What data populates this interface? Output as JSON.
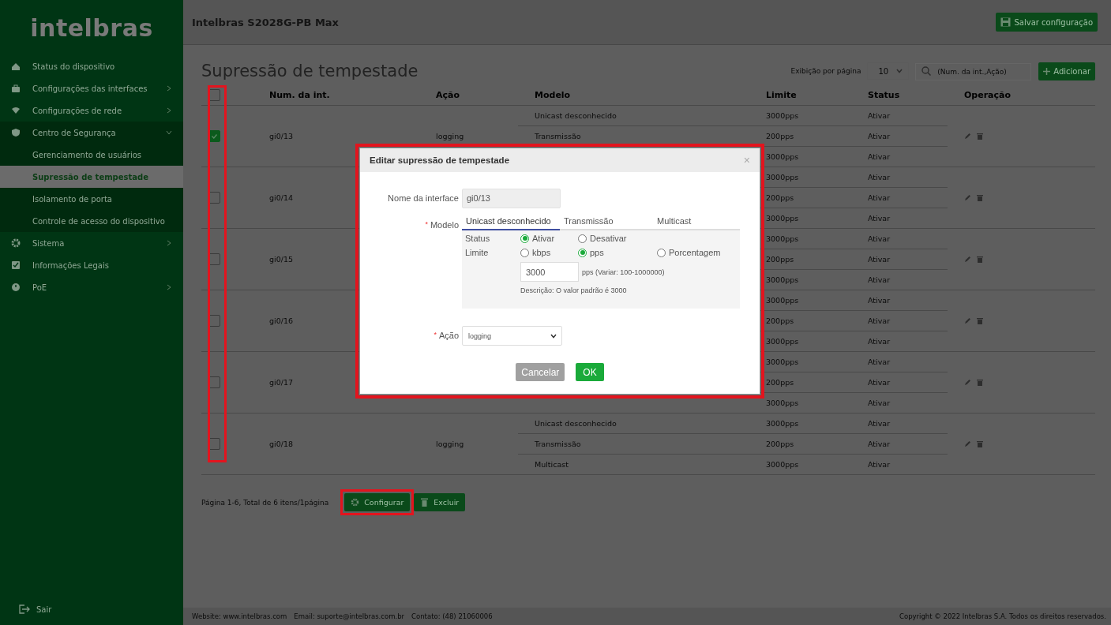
{
  "sidebar": {
    "logo": "intelbras",
    "items": [
      {
        "label": "Status do dispositivo",
        "kind": "link",
        "selected": false
      },
      {
        "label": "Configurações das interfaces",
        "kind": "group",
        "expanded": false,
        "selected": false
      },
      {
        "label": "Configurações de rede",
        "kind": "group",
        "expanded": false,
        "selected": false
      },
      {
        "label": "Centro de Segurança",
        "kind": "group",
        "expanded": true,
        "selected": false,
        "children": [
          {
            "label": "Gerenciamento de usuários",
            "selected": false
          },
          {
            "label": "Supressão de tempestade",
            "selected": true
          },
          {
            "label": "Isolamento de porta",
            "selected": false
          },
          {
            "label": "Controle de acesso do dispositivo",
            "selected": false
          }
        ]
      },
      {
        "label": "Sistema",
        "kind": "group",
        "expanded": false,
        "selected": false
      },
      {
        "label": "Informações Legais",
        "kind": "link",
        "selected": false
      },
      {
        "label": "PoE",
        "kind": "group",
        "expanded": false,
        "selected": false
      }
    ],
    "logout": "Sair"
  },
  "header": {
    "title": "Intelbras S2028G-PB Max",
    "save_button": "Salvar configuração"
  },
  "page": {
    "title": "Supressão de tempestade",
    "per_page_label": "Exibição por página",
    "per_page_value": "10",
    "search_placeholder": "(Num. da int.,Ação)",
    "add_button": "Adicionar"
  },
  "table": {
    "select_all_checked": false,
    "checkbox_column_highlighted": true,
    "columns": [
      "Num. da int.",
      "Ação",
      "Modelo",
      "Limite",
      "Status",
      "Operação"
    ],
    "rows": [
      {
        "checked": true,
        "interface": "gi0/13",
        "action": "logging",
        "models": [
          {
            "model": "Unicast desconhecido",
            "limit": "3000pps",
            "status": "Ativar"
          },
          {
            "model": "Transmissão",
            "limit": "200pps",
            "status": "Ativar"
          },
          {
            "limit": "3000pps",
            "status": "Ativar"
          }
        ]
      },
      {
        "checked": false,
        "interface": "gi0/14",
        "models": [
          {
            "limit": "3000pps",
            "status": "Ativar"
          },
          {
            "limit": "200pps",
            "status": "Ativar"
          },
          {
            "limit": "3000pps",
            "status": "Ativar"
          }
        ]
      },
      {
        "checked": false,
        "interface": "gi0/15",
        "models": [
          {
            "limit": "3000pps",
            "status": "Ativar"
          },
          {
            "limit": "200pps",
            "status": "Ativar"
          },
          {
            "limit": "3000pps",
            "status": "Ativar"
          }
        ]
      },
      {
        "checked": false,
        "interface": "gi0/16",
        "models": [
          {
            "limit": "3000pps",
            "status": "Ativar"
          },
          {
            "limit": "200pps",
            "status": "Ativar"
          },
          {
            "limit": "3000pps",
            "status": "Ativar"
          }
        ]
      },
      {
        "checked": false,
        "interface": "gi0/17",
        "models": [
          {
            "limit": "3000pps",
            "status": "Ativar"
          },
          {
            "limit": "200pps",
            "status": "Ativar"
          },
          {
            "limit": "3000pps",
            "status": "Ativar"
          }
        ]
      },
      {
        "checked": false,
        "interface": "gi0/18",
        "action": "logging",
        "models": [
          {
            "model": "Unicast desconhecido",
            "limit": "3000pps",
            "status": "Ativar"
          },
          {
            "model": "Transmissão",
            "limit": "200pps",
            "status": "Ativar"
          },
          {
            "model": "Multicast",
            "limit": "3000pps",
            "status": "Ativar"
          }
        ]
      }
    ]
  },
  "pagination": {
    "summary": "Página 1-6, Total de 6 itens/1página",
    "buttons": [
      {
        "label": "Configurar",
        "kind": "configure",
        "highlighted": true
      },
      {
        "label": "Excluir",
        "kind": "delete",
        "highlighted": false
      }
    ]
  },
  "dialog": {
    "title": "Editar supressão de tempestade",
    "close": "×",
    "highlighted": true,
    "interface_label": "Nome da interface",
    "interface_value": "gi0/13",
    "model_label": "Modelo",
    "required_mark": "*",
    "model_tabs": [
      {
        "label": "Unicast desconhecido",
        "selected": true
      },
      {
        "label": "Transmissão",
        "selected": false
      },
      {
        "label": "Multicast",
        "selected": false
      }
    ],
    "status_label": "Status",
    "status_options": [
      {
        "label": "Ativar",
        "selected": true
      },
      {
        "label": "Desativar",
        "selected": false
      }
    ],
    "limit_label": "Limite",
    "limit_options": [
      {
        "label": "kbps",
        "selected": false
      },
      {
        "label": "pps",
        "selected": true
      },
      {
        "label": "Porcentagem",
        "selected": false
      }
    ],
    "limit_value": "3000",
    "limit_hint": "pps  (Variar: 100-1000000)",
    "description": "Descrição: O valor padrão é 3000",
    "action_label": "Ação",
    "action_value": "logging",
    "cancel_button": "Cancelar",
    "ok_button": "OK"
  },
  "footer": {
    "website": "Website: www.intelbras.com",
    "email": "Email: suporte@intelbras.com.br",
    "contact": "Contato: (48) 21060006",
    "copyright": "Copyright © 2022 Intelbras S.A. Todos os direitos reservados."
  }
}
